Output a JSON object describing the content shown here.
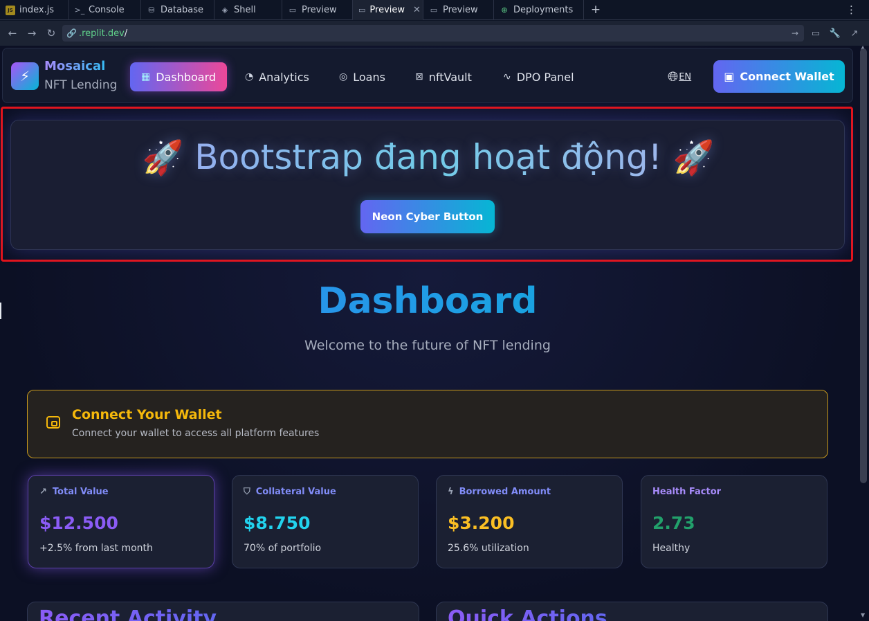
{
  "ide": {
    "tabs": [
      {
        "label": "index.js",
        "icon": "js-file-icon",
        "active": false
      },
      {
        "label": "Console",
        "icon": "terminal-icon",
        "active": false
      },
      {
        "label": "Database",
        "icon": "database-icon",
        "active": false
      },
      {
        "label": "Shell",
        "icon": "shell-icon",
        "active": false
      },
      {
        "label": "Preview",
        "icon": "monitor-icon",
        "active": false
      },
      {
        "label": "Preview",
        "icon": "monitor-icon",
        "active": true
      },
      {
        "label": "Preview",
        "icon": "monitor-icon",
        "active": false
      },
      {
        "label": "Deployments",
        "icon": "deploy-icon",
        "active": false
      }
    ],
    "url_domain": ".replit.dev",
    "url_path": "/"
  },
  "nav": {
    "brand_name": "Mosaical",
    "brand_sub": "NFT Lending",
    "links": [
      {
        "label": "Dashboard",
        "icon": "grid-icon",
        "active": true
      },
      {
        "label": "Analytics",
        "icon": "pie-chart-icon",
        "active": false
      },
      {
        "label": "Loans",
        "icon": "coins-icon",
        "active": false
      },
      {
        "label": "nftVault",
        "icon": "vault-icon",
        "active": false
      },
      {
        "label": "DPO Panel",
        "icon": "activity-icon",
        "active": false
      }
    ],
    "language": "EN",
    "connect_wallet": "Connect Wallet"
  },
  "hero": {
    "emoji_left": "🚀",
    "title": "Bootstrap đang hoạt động!",
    "emoji_right": "🚀",
    "button": "Neon Cyber Button"
  },
  "dashboard": {
    "title": "Dashboard",
    "subtitle": "Welcome to the future of NFT lending"
  },
  "wallet_notice": {
    "title": "Connect Your Wallet",
    "text": "Connect your wallet to access all platform features"
  },
  "stats": [
    {
      "label": "Total Value",
      "icon": "trending-up-icon",
      "value": "$12.500",
      "note": "+2.5% from last month",
      "label_color": "#818cf8",
      "value_color": "#8b5cf6"
    },
    {
      "label": "Collateral Value",
      "icon": "shield-icon",
      "value": "$8.750",
      "note": "70% of portfolio",
      "label_color": "#818cf8",
      "value_color": "#22d3ee"
    },
    {
      "label": "Borrowed Amount",
      "icon": "lightning-icon",
      "value": "$3.200",
      "note": "25.6% utilization",
      "label_color": "#818cf8",
      "value_color": "#fbbf24"
    },
    {
      "label": "Health Factor",
      "icon": "",
      "value": "2.73",
      "note": "Healthy",
      "label_color": "#a78bfa",
      "value_color": "#22a06b"
    }
  ],
  "panels": {
    "recent_activity": "Recent Activity",
    "quick_actions": "Quick Actions"
  }
}
